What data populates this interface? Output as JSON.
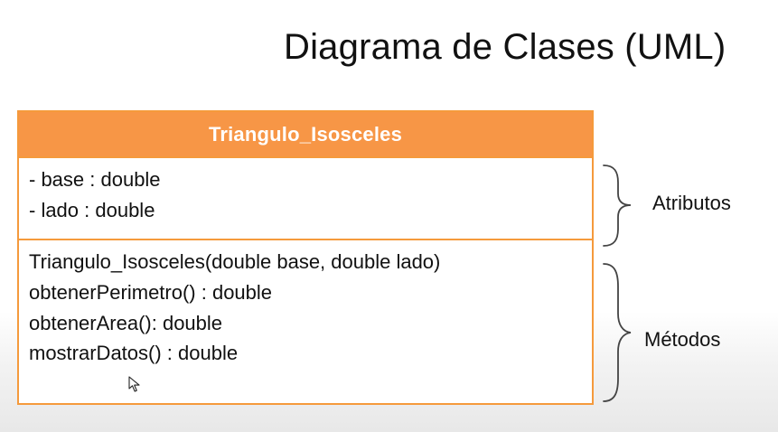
{
  "title": "Diagrama de Clases (UML)",
  "class_box": {
    "name": "Triangulo_Isosceles",
    "attributes": [
      "- base : double",
      "- lado : double"
    ],
    "methods": [
      "Triangulo_Isosceles(double base, double lado)",
      "obtenerPerimetro() : double",
      "obtenerArea(): double",
      "mostrarDatos() : double"
    ]
  },
  "annotations": {
    "attributes_label": "Atributos",
    "methods_label": "Métodos"
  },
  "colors": {
    "header_fill": "#f79646",
    "border": "#f59a3c",
    "text": "#111111"
  },
  "icons": {
    "cursor": "cursor-icon",
    "attributes_brace": "brace-icon",
    "methods_brace": "brace-icon"
  }
}
